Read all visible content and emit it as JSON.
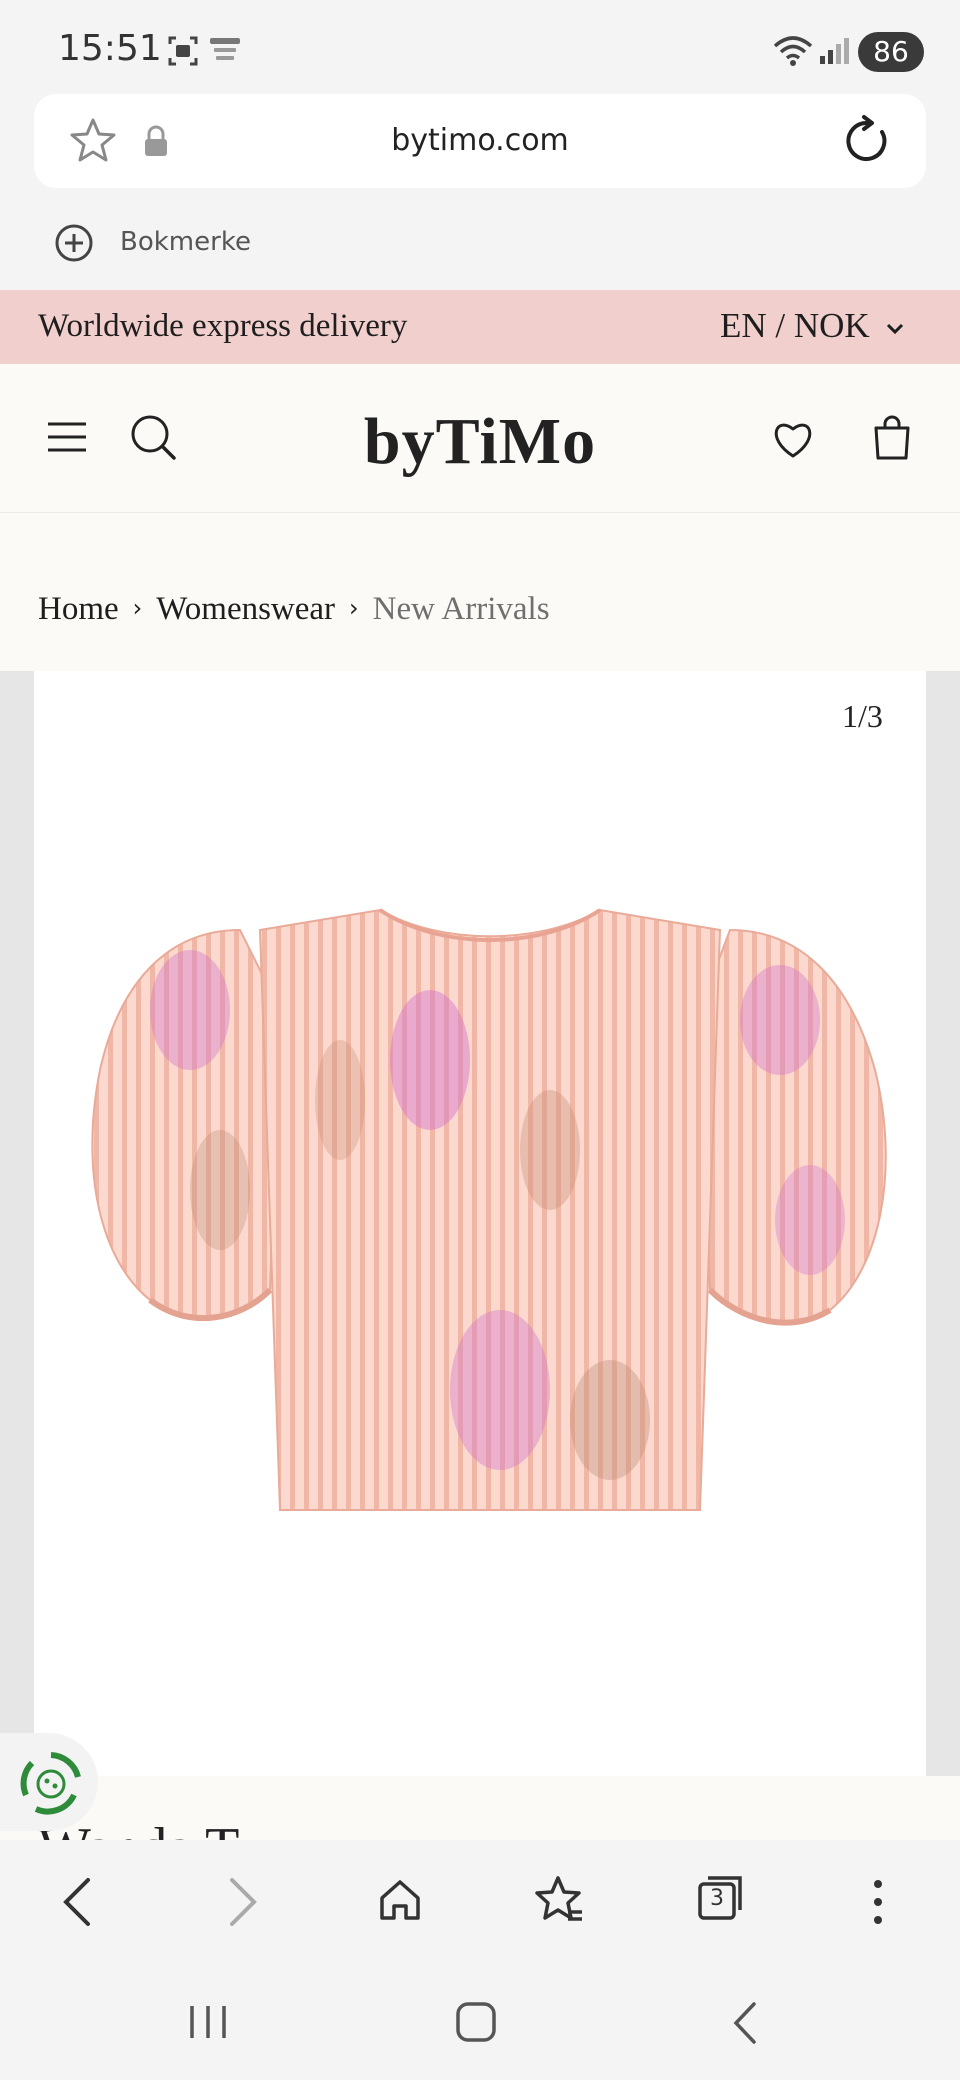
{
  "status": {
    "time": "15:51",
    "battery": "86"
  },
  "browser": {
    "url": "bytimo.com",
    "bookmark_label": "Bokmerke",
    "tab_count": "3"
  },
  "promo": {
    "text": "Worldwide express delivery",
    "lang_currency": "EN / NOK"
  },
  "site": {
    "logo": "byTiMo"
  },
  "breadcrumb": {
    "home": "Home",
    "category": "Womenswear",
    "current": "New Arrivals"
  },
  "gallery": {
    "counter": "1/3"
  },
  "product": {
    "title_partial": "Wanda T"
  },
  "colors": {
    "promo_bg": "#f1cfcd",
    "page_bg": "#fbfaf7",
    "blouse": "#f4c6b9"
  }
}
